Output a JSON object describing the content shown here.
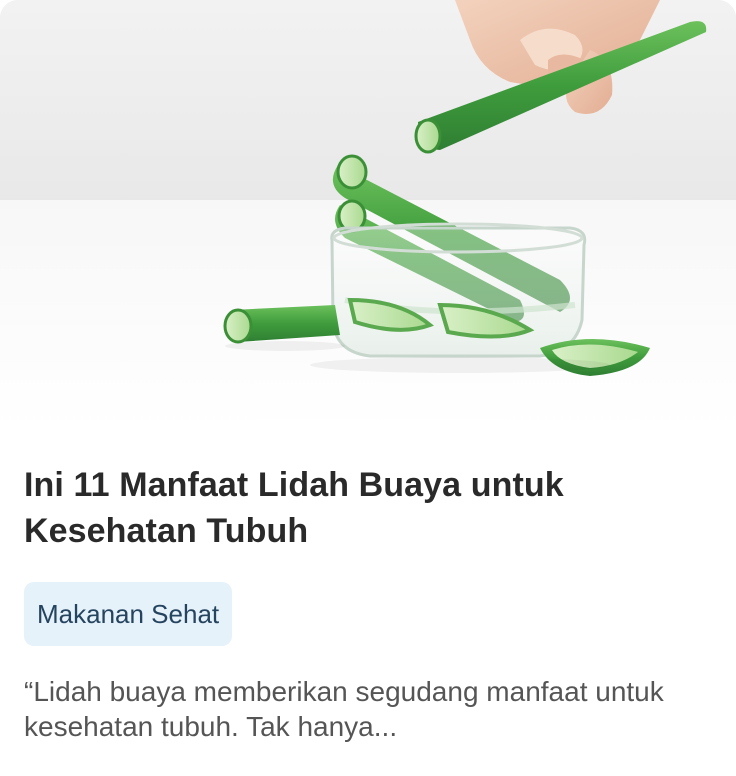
{
  "article": {
    "image_subject": "aloe-vera-photo",
    "title": "Ini 11 Manfaat Lidah Buaya untuk Kesehatan Tubuh",
    "category": "Makanan Sehat",
    "excerpt": "“Lidah buaya memberikan segudang manfaat untuk kesehatan tubuh. Tak hanya..."
  },
  "colors": {
    "title": "#2a2a2a",
    "tag_background": "#e6f2fa",
    "tag_text": "#25445f",
    "excerpt": "#555555",
    "aloe_green": "#4fa64a"
  }
}
